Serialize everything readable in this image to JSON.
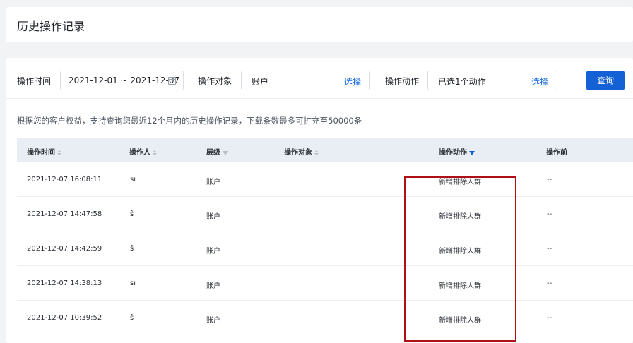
{
  "page": {
    "title": "历史操作记录"
  },
  "filters": {
    "time_label": "操作时间",
    "time_value": "2021-12-01 ~ 2021-12-07",
    "object_label": "操作对象",
    "object_value": "账户",
    "object_select": "选择",
    "action_label": "操作动作",
    "action_value": "已选1个动作",
    "action_select": "选择",
    "query_button": "查询"
  },
  "notice": "根据您的客户权益，支持查询您最近12个月内的历史操作记录，下载条数最多可扩充至50000条",
  "table": {
    "headers": [
      "操作时间",
      "操作人",
      "层级",
      "操作对象",
      "操作动作",
      "操作前"
    ],
    "rows": [
      {
        "time": "2021-12-07 16:08:11",
        "operator": "sı",
        "level": "账户",
        "object": "",
        "action": "新增排除人群",
        "before": "--"
      },
      {
        "time": "2021-12-07 14:47:58",
        "operator": "ŝ",
        "level": "账户",
        "object": "",
        "action": "新增排除人群",
        "before": "--"
      },
      {
        "time": "2021-12-07 14:42:59",
        "operator": "ŝ",
        "level": "账户",
        "object": "",
        "action": "新增排除人群",
        "before": "--"
      },
      {
        "time": "2021-12-07 14:38:13",
        "operator": "sı",
        "level": "账户",
        "object": "",
        "action": "新增排除人群",
        "before": "--"
      },
      {
        "time": "2021-12-07 10:39:52",
        "operator": "ŝ",
        "level": "账户",
        "object": "",
        "action": "新增排除人群",
        "before": "--"
      }
    ]
  },
  "colors": {
    "primary": "#1461d6",
    "highlight": "#b00f17",
    "header_bg": "#e9edf4"
  }
}
